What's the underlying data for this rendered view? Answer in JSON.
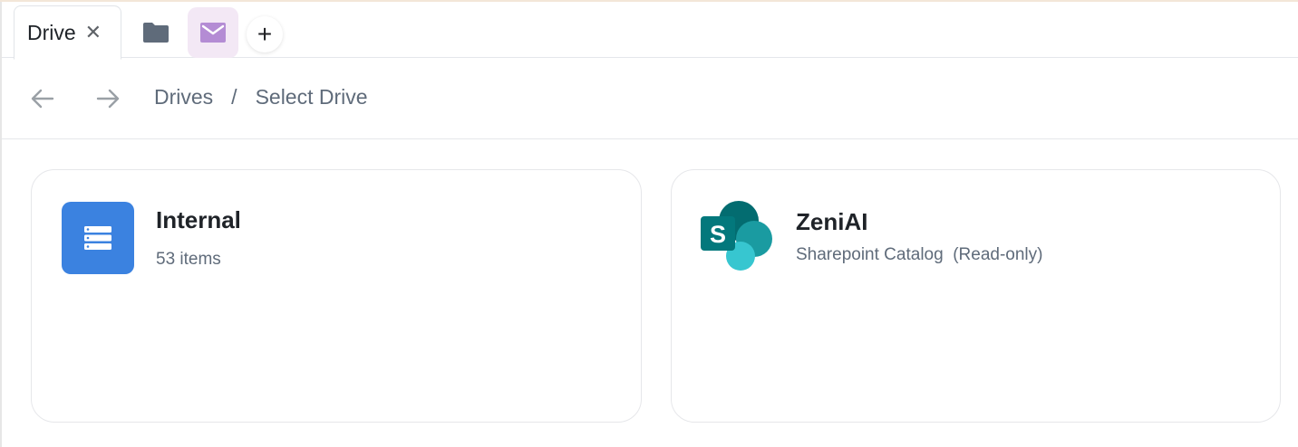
{
  "tabs": {
    "active": {
      "label": "Drive",
      "close_glyph": "✕"
    },
    "folder_icon": "folder-icon",
    "mail_icon": "mail-icon",
    "add_label": "+"
  },
  "nav": {
    "back_icon": "arrow-left-icon",
    "forward_icon": "arrow-right-icon",
    "breadcrumb": {
      "root": "Drives",
      "separator": "/",
      "current": "Select Drive"
    }
  },
  "drives": [
    {
      "name": "Internal",
      "meta": "53 items",
      "icon": "server-icon",
      "color": "#3b82e0"
    },
    {
      "name": "ZeniAI",
      "meta": "Sharepoint Catalog  (Read-only)",
      "icon": "sharepoint-icon"
    }
  ],
  "colors": {
    "accent_blue": "#3b82e0",
    "mail_tab_bg": "#f3e8f5",
    "mail_icon": "#b48cd4",
    "folder_icon": "#5f6b7a",
    "muted_text": "#5f6b7a",
    "border": "#e6e7ea"
  }
}
